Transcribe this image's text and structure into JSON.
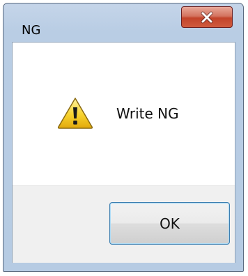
{
  "window": {
    "title": "NG"
  },
  "message": {
    "text": "Write NG",
    "icon": "warning-icon"
  },
  "buttons": {
    "ok_label": "OK",
    "close_icon": "close-icon"
  },
  "colors": {
    "frame": "#b9cde4",
    "close_button": "#c2432a",
    "ok_focus_border": "#3c7fb1",
    "button_area": "#f0f0f0"
  }
}
